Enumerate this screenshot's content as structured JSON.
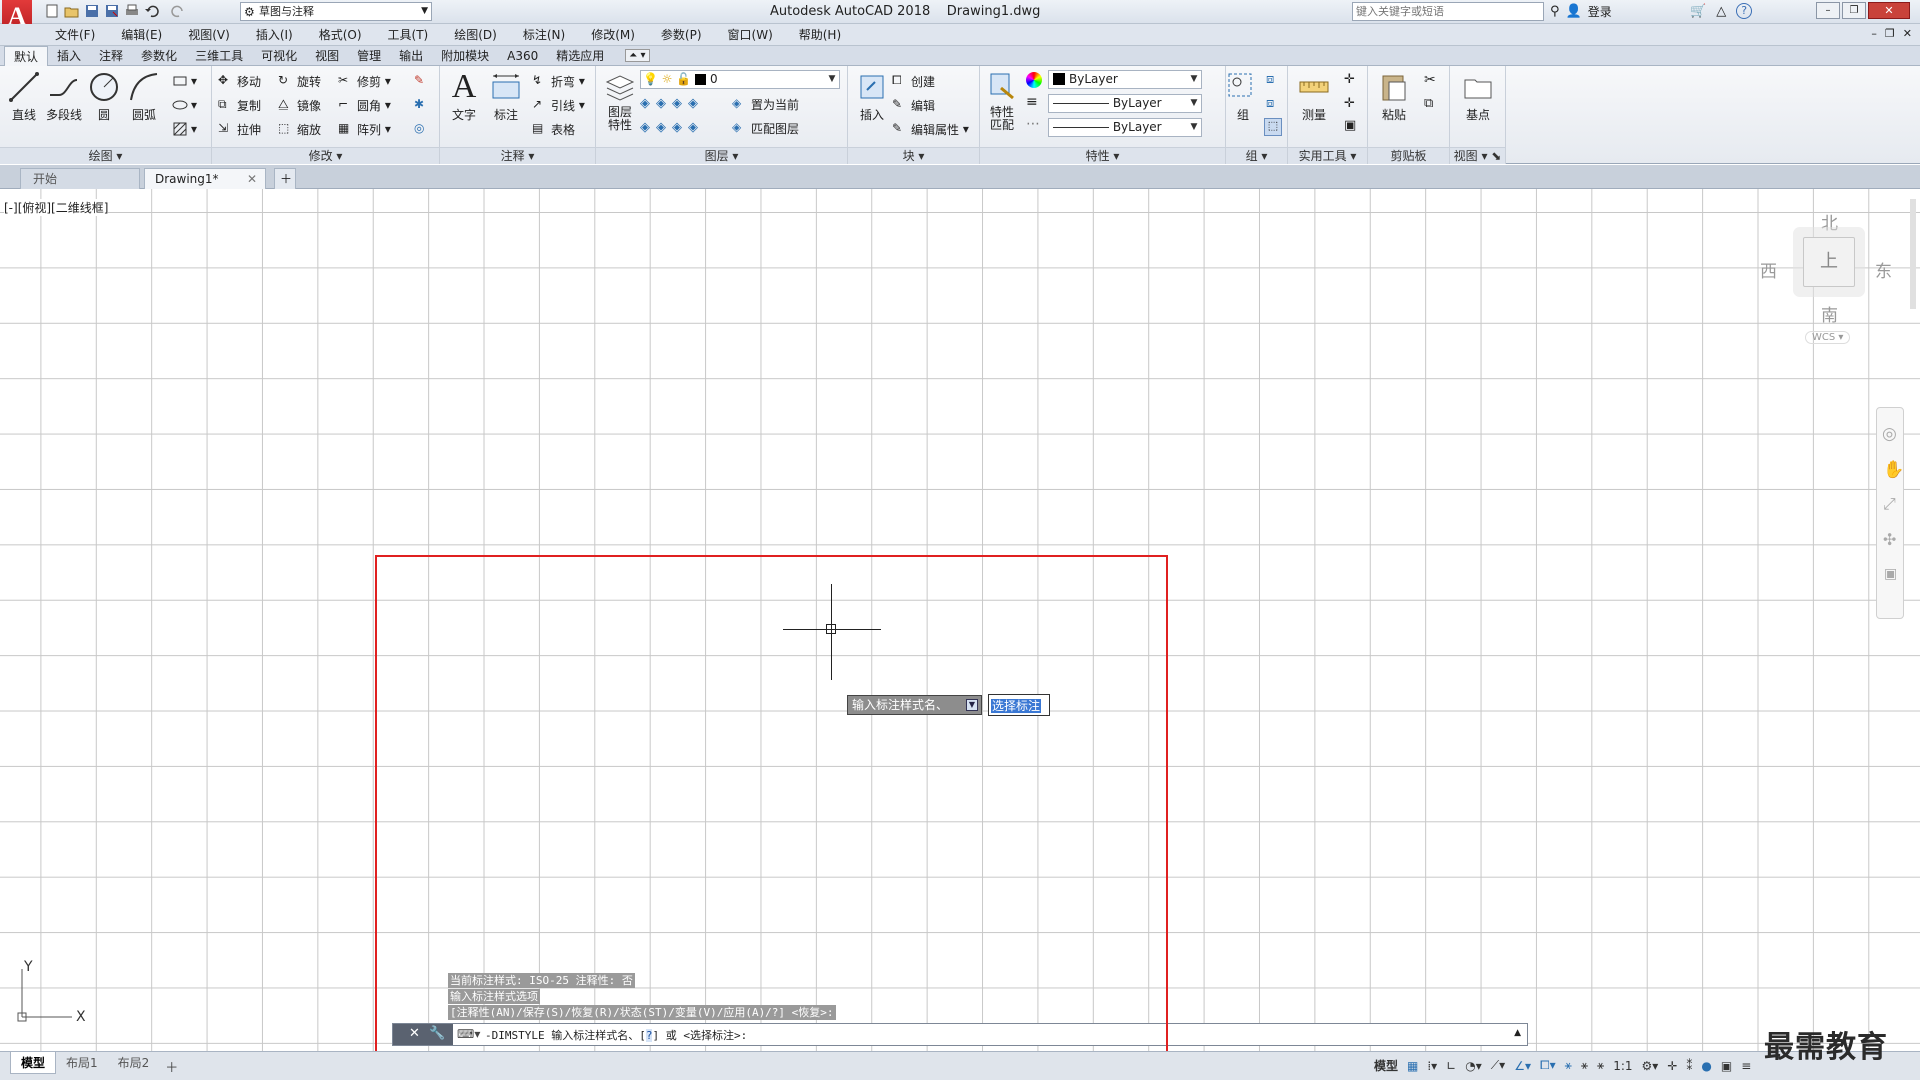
{
  "titlebar": {
    "workspace": "草图与注释",
    "app_title": "Autodesk AutoCAD 2018",
    "file_name": "Drawing1.dwg",
    "search_placeholder": "键入关键字或短语",
    "login": "登录"
  },
  "menu": [
    "文件(F)",
    "编辑(E)",
    "视图(V)",
    "插入(I)",
    "格式(O)",
    "工具(T)",
    "绘图(D)",
    "标注(N)",
    "修改(M)",
    "参数(P)",
    "窗口(W)",
    "帮助(H)"
  ],
  "ribbon_tabs": [
    "默认",
    "插入",
    "注释",
    "参数化",
    "三维工具",
    "可视化",
    "视图",
    "管理",
    "输出",
    "附加模块",
    "A360",
    "精选应用"
  ],
  "ribbon": {
    "draw": {
      "title": "绘图",
      "line": "直线",
      "polyline": "多段线",
      "circle": "圆",
      "arc": "圆弧"
    },
    "modify": {
      "title": "修改",
      "move": "移动",
      "rotate": "旋转",
      "trim": "修剪",
      "copy": "复制",
      "mirror": "镜像",
      "fillet": "圆角",
      "stretch": "拉伸",
      "scale": "缩放",
      "array": "阵列"
    },
    "annotation": {
      "title": "注释",
      "text": "文字",
      "dimension": "标注",
      "leader_fold": "折弯",
      "leader": "引线",
      "table": "表格"
    },
    "layers": {
      "title": "图层",
      "layer_props_1": "图层",
      "layer_props_2": "特性",
      "current_layer": "0",
      "make_current": "置为当前",
      "match_layer": "匹配图层"
    },
    "block": {
      "title": "块",
      "insert": "插入",
      "create": "创建",
      "edit": "编辑",
      "edit_attr": "编辑属性"
    },
    "properties": {
      "title": "特性",
      "match_1": "特性",
      "match_2": "匹配",
      "color": "ByLayer",
      "linetype": "ByLayer",
      "lineweight": "ByLayer"
    },
    "groups": {
      "title": "组",
      "group": "组"
    },
    "utilities": {
      "title": "实用工具",
      "measure": "测量"
    },
    "clipboard": {
      "title": "剪贴板",
      "paste": "粘贴"
    },
    "view": {
      "title": "视图",
      "base": "基点"
    }
  },
  "doc_tabs": {
    "start": "开始",
    "drawing": "Drawing1*"
  },
  "viewport_label": "[-][俯视][二维线框]",
  "viewcube": {
    "north": "北",
    "south": "南",
    "east": "东",
    "west": "西",
    "top": "上",
    "wcs": "WCS"
  },
  "dynamic_input": {
    "prompt": "输入标注样式名、",
    "value": "选择标注"
  },
  "command_history": [
    "当前标注样式: ISO-25   注释性: 否",
    "输入标注样式选项",
    "[注释性(AN)/保存(S)/恢复(R)/状态(ST)/变量(V)/应用(A)/?] <恢复>:"
  ],
  "command_line": {
    "text_before": "-DIMSTYLE 输入标注样式名、[",
    "highlight": "?",
    "text_after": "] 或 <选择标注>:"
  },
  "layout_tabs": [
    "模型",
    "布局1",
    "布局2"
  ],
  "status": {
    "model": "模型",
    "scale": "1:1"
  },
  "watermark": "最需教育",
  "colors": {
    "selection_rect": "#e02020",
    "accent": "#c0141b",
    "canvas_grid": "#c8c8c8"
  }
}
